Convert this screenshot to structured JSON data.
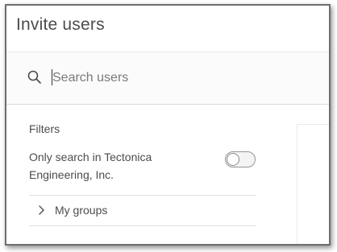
{
  "dialog": {
    "title": "Invite users"
  },
  "search": {
    "placeholder": "Search users",
    "value": "",
    "icon": "search-icon"
  },
  "filters": {
    "heading": "Filters",
    "org_toggle": {
      "label": "Only search in Tectonica Engineering, Inc.",
      "checked": false
    },
    "groups": {
      "label": "My groups",
      "expanded": false,
      "icon": "chevron-right-icon"
    }
  },
  "colors": {
    "text": "#4c4c4c",
    "border": "#6e6e6e",
    "divider": "#e0e0e0",
    "search_bg": "#fbfbfb"
  }
}
